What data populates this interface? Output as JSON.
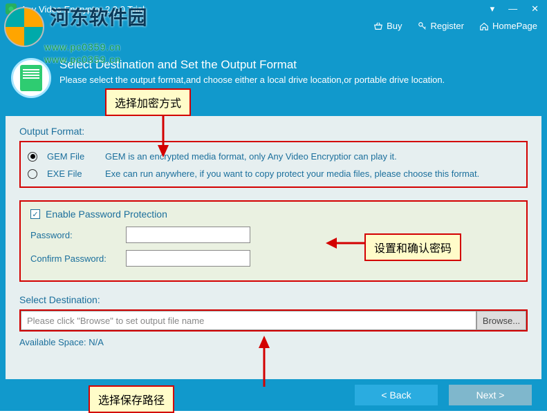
{
  "window": {
    "title": "Any Video Encryptor 2.0.0 Trial"
  },
  "menubar": {
    "buy": "Buy",
    "register": "Register",
    "homepage": "HomePage"
  },
  "header": {
    "title": "Select Destination and Set the Output Format",
    "subtitle": "Please select the output format,and choose either a local drive location,or portable drive location."
  },
  "output_format": {
    "label": "Output Format:",
    "options": [
      {
        "name": "GEM File",
        "desc": "GEM is an encrypted media format, only Any Video Encryptior can play it.",
        "selected": true
      },
      {
        "name": "EXE File",
        "desc": "Exe can run anywhere, if you want to copy protect your media files, please choose this format.",
        "selected": false
      }
    ]
  },
  "password": {
    "enable_label": "Enable Password Protection",
    "checked": true,
    "password_label": "Password:",
    "confirm_label": "Confirm Password:"
  },
  "destination": {
    "label": "Select Destination:",
    "placeholder": "Please click \"Browse\" to set output file name",
    "browse": "Browse...",
    "available": "Available Space: N/A"
  },
  "footer": {
    "back": "< Back",
    "next": "Next >"
  },
  "annotations": {
    "a1": "选择加密方式",
    "a2": "设置和确认密码",
    "a3": "选择保存路径"
  },
  "watermark": {
    "text1": "河东软件园",
    "text2": "www.pc0359.cn"
  }
}
